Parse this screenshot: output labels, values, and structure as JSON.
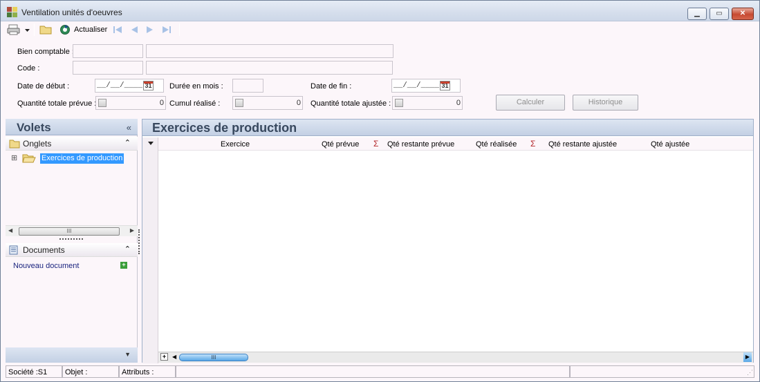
{
  "window": {
    "title": "Ventilation unités d'oeuvres",
    "btn_min": "▁",
    "btn_max": "▭",
    "btn_close": "✕"
  },
  "toolbar": {
    "refresh_label": "Actualiser",
    "icons": [
      "printer-icon",
      "dropdown-arrow-icon",
      "folder-icon",
      "refresh-icon",
      "first-record-icon",
      "previous-record-icon",
      "next-record-icon",
      "last-record-icon"
    ]
  },
  "form": {
    "bien_comptable_label": "Bien comptable :",
    "code_label": "Code :",
    "date_debut_label": "Date de début :",
    "date_debut_value": "__/__/____",
    "duree_label": "Durée en mois :",
    "date_fin_label": "Date de fin :",
    "date_fin_value": "__/__/____",
    "calendar_glyph": "31",
    "qte_prevue_label": "Quantité totale prévue :",
    "qte_prevue_value": "0",
    "cumul_label": "Cumul réalisé :",
    "cumul_value": "0",
    "qte_ajustee_label": "Quantité totale ajustée :",
    "qte_ajustee_value": "0",
    "calculer_label": "Calculer",
    "historique_label": "Historique"
  },
  "left_panel": {
    "title": "Volets",
    "collapse_glyph": "«",
    "onglets_title": "Onglets",
    "documents_title": "Documents",
    "section_toggle": "⌃",
    "tree_expander": "⊞",
    "tree_item": "Exercices de production",
    "new_doc_label": "Nouveau document",
    "new_doc_icon": "+",
    "footer_arrow": "▼"
  },
  "main_panel": {
    "title": "Exercices de production",
    "sum_glyph": "Σ",
    "columns": [
      "Exercice",
      "Qté prévue",
      "Qté restante prévue",
      "Qté réalisée",
      "Qté restante ajustée",
      "Qté ajustée"
    ],
    "add_row": "+"
  },
  "statusbar": {
    "societe": "Société :S1",
    "objet": "Objet :",
    "attributs": "Attributs :"
  },
  "colors": {
    "panel_header_text": "#38485e",
    "selection": "#3399ff",
    "sum_red": "#b3262a",
    "background": "#fcf6fa"
  }
}
